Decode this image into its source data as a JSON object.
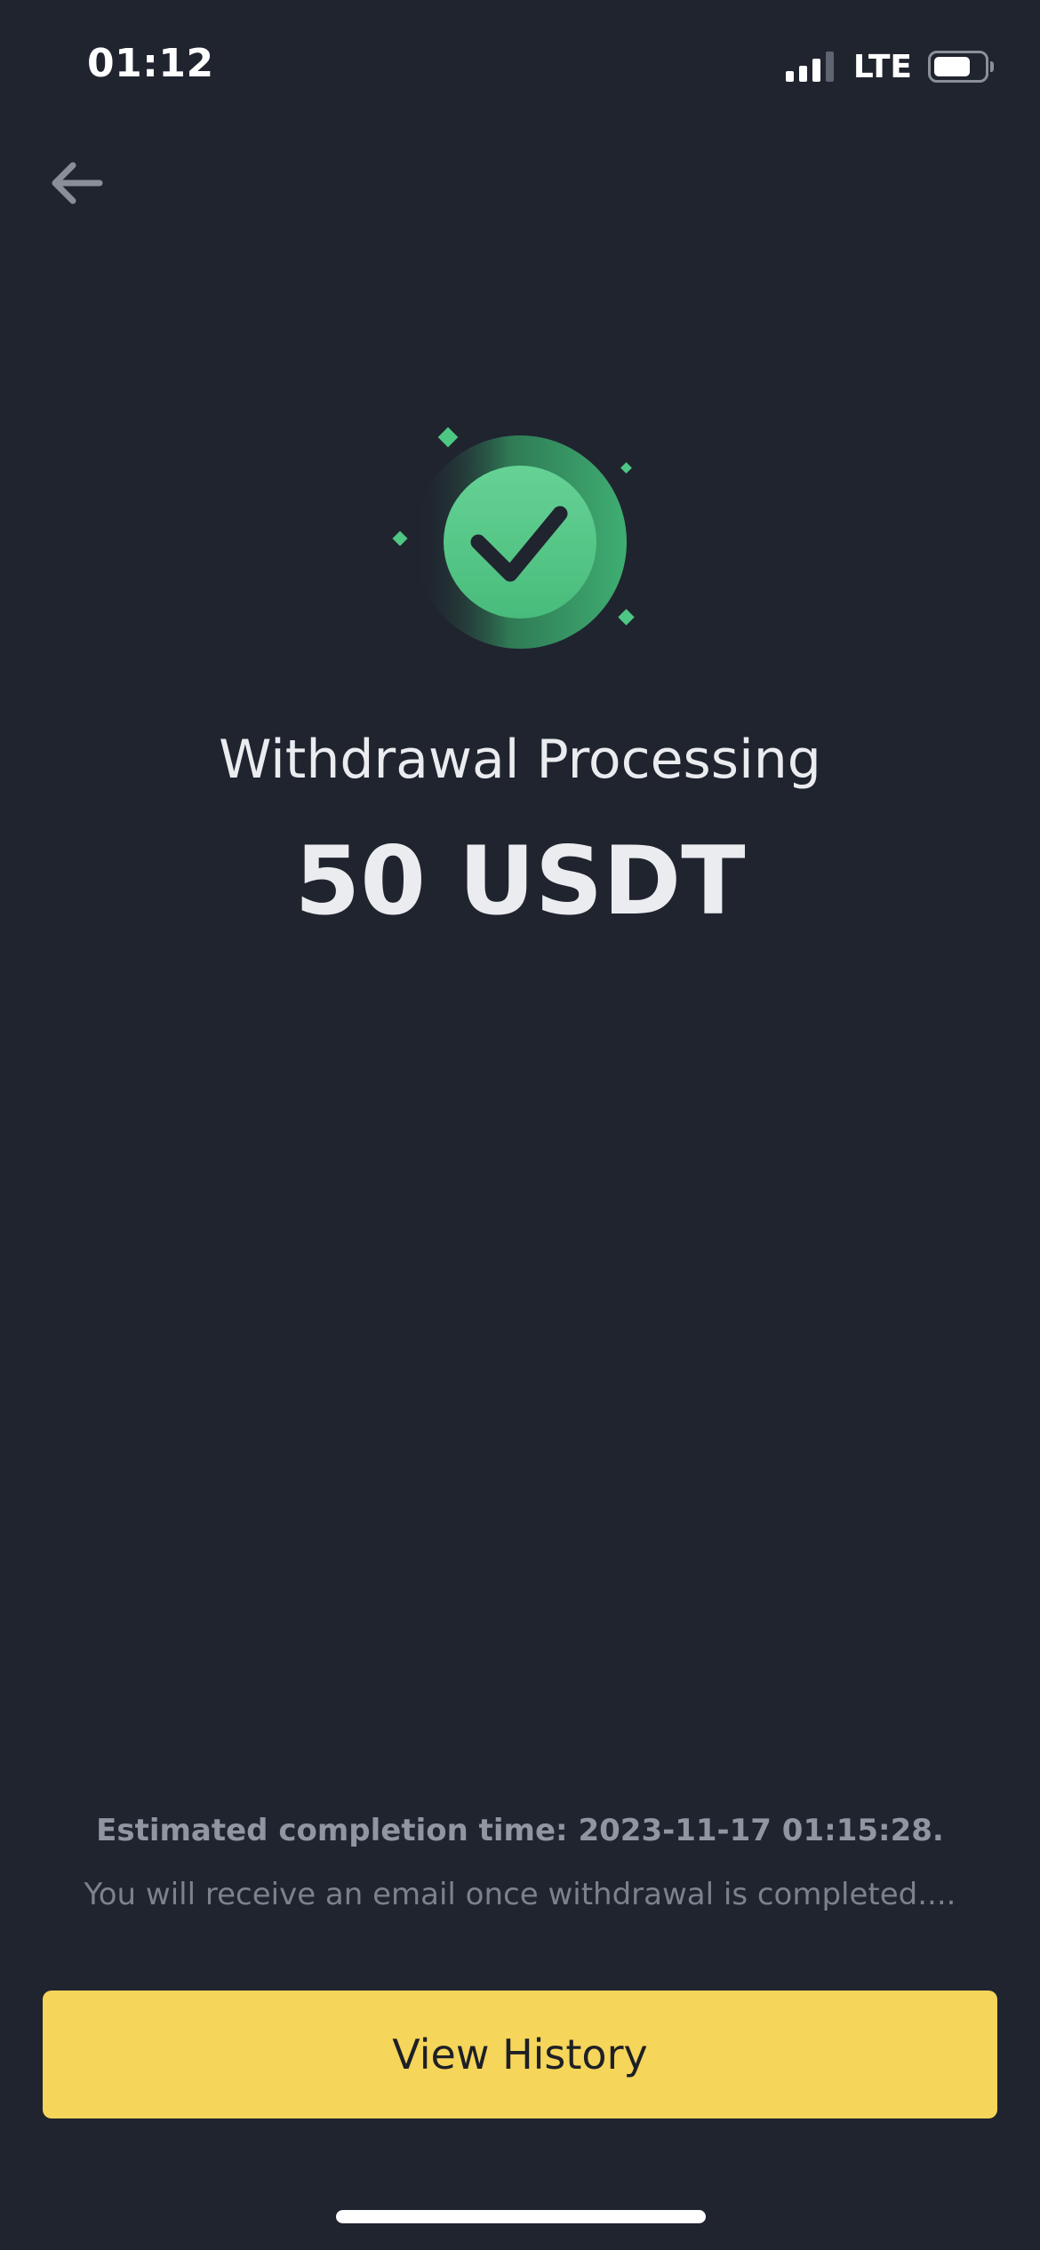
{
  "status_bar": {
    "time": "01:12",
    "network": "LTE",
    "icons": [
      "signal-icon",
      "battery-icon"
    ]
  },
  "nav": {
    "back_icon": "back-arrow-icon"
  },
  "result": {
    "icon": "success-check-icon",
    "title": "Withdrawal Processing",
    "amount": "50 USDT"
  },
  "info": {
    "estimated_completion": "Estimated completion time: 2023-11-17 01:15:28.",
    "email_note": "You will receive an email once withdrawal is completed...."
  },
  "actions": {
    "view_history_label": "View History"
  },
  "colors": {
    "background": "#20242f",
    "accent_yellow": "#f5d55a",
    "success_green": "#4fc784",
    "text_primary": "#eaecef",
    "text_secondary": "#8f95a1"
  }
}
